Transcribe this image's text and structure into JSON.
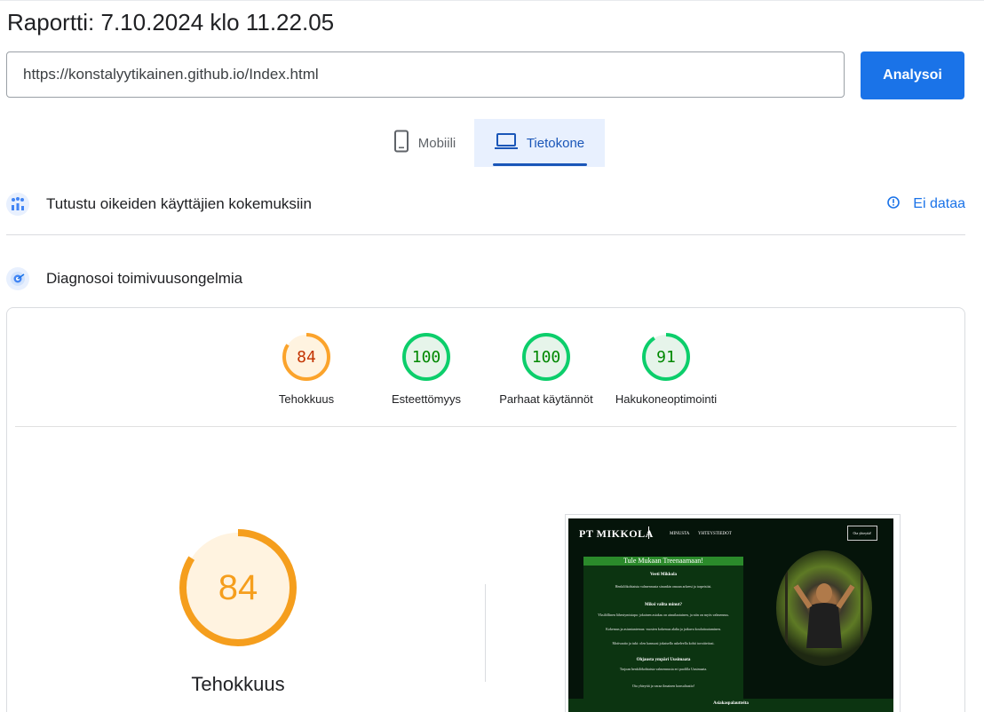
{
  "report": {
    "title": "Raportti: 7.10.2024 klo 11.22.05"
  },
  "url_input": {
    "value": "https://konstalyytikainen.github.io/Index.html"
  },
  "analyze_button": {
    "label": "Analysoi"
  },
  "tabs": [
    {
      "label": "Mobiili",
      "icon": "phone-icon",
      "selected": false
    },
    {
      "label": "Tietokone",
      "icon": "laptop-icon",
      "selected": true
    }
  ],
  "sections": {
    "real_users": {
      "title": "Tutustu oikeiden käyttäjien kokemuksiin",
      "icon": "users-chart-icon",
      "nodata": "Ei dataa"
    },
    "diagnose": {
      "title": "Diagnosoi toimivuusongelmia",
      "icon": "lighthouse-icon"
    }
  },
  "scores": [
    {
      "label": "Tehokkuus",
      "value": "84",
      "ring": "#fba32b",
      "fill": "#fff3e0",
      "text": "#c33300"
    },
    {
      "label": "Esteettömyys",
      "value": "100",
      "ring": "#0cce6b",
      "fill": "#e6f4ea",
      "text": "#008800"
    },
    {
      "label": "Parhaat käytännöt",
      "value": "100",
      "ring": "#0cce6b",
      "fill": "#e6f4ea",
      "text": "#008800"
    },
    {
      "label": "Hakukoneoptimointi",
      "value": "91",
      "ring": "#0cce6b",
      "fill": "#e6f4ea",
      "text": "#008800"
    }
  ],
  "main_score": {
    "label": "Tehokkuus",
    "value": "84",
    "color": "#f59e1d"
  },
  "screenshot": {
    "brand": "PT MIKKOLA",
    "nav": [
      "MINUSTA",
      "YHTEYSTIEDOT"
    ],
    "button": "Ota yhteyttä!",
    "heading": "Tule Mukaan Treenaamaan!",
    "name": "Veeti Mikkola",
    "intro": "Henkilökohtaista valmennusta sinunkin omaan arkeesi ja tarpeisiisi.",
    "why_title": "Miksi valita minut?",
    "why_1": "Yksilöllinen lähestymistapa: jokainen asiakas on ainutlaatuinen, ja niin on myös valmennus.",
    "why_2": "Kokemus ja asiantuntemus: vuosien kokemus alalta ja jatkuva kouluttautuminen.",
    "why_3": "Motivaatio ja tuki: olen kanssasi jokaisella askeleella kohti tavoitteitasi.",
    "area_title": "Ohjausta ympäri Uusimaata",
    "area_text": "Tarjoan henkilökohtaista valmennusta eri puolilla Uusimaata.",
    "cta": "Ota yhteyttä ja varaa ilmainen konsultaatio!",
    "footer": "Asiakaspalautteita"
  }
}
